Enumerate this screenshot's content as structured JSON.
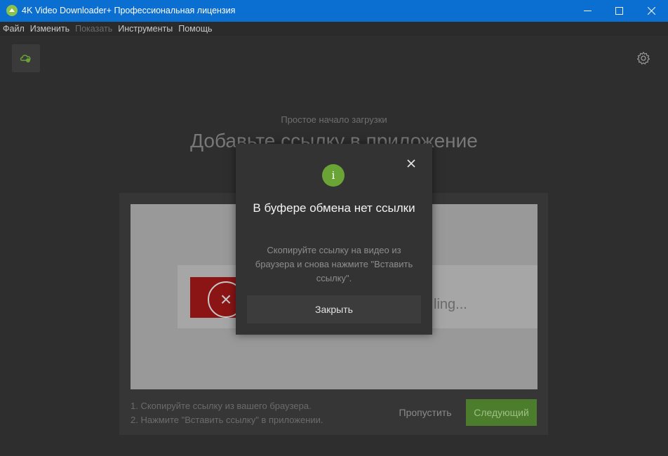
{
  "window": {
    "title": "4K Video Downloader+ Профессиональная лицензия"
  },
  "menu": {
    "items": [
      "Файл",
      "Изменить",
      "Показать",
      "Инструменты",
      "Помощь"
    ]
  },
  "toolbar": {
    "smart_mode_icon": "smart-mode-icon",
    "settings_icon": "gear-icon"
  },
  "onboarding": {
    "subtitle": "Простое начало загрузки",
    "title": "Добавьте ссылку в приложение",
    "preview_text": "ling...",
    "steps": [
      "1. Скопируйте ссылку из вашего браузера.",
      "2. Нажмите \"Вставить ссылку\" в приложении."
    ],
    "skip_label": "Пропустить",
    "next_label": "Следующий"
  },
  "dialog": {
    "title": "В буфере обмена нет ссылки",
    "message": "Скопируйте ссылку на видео из браузера и снова нажмите \"Вставить ссылку\".",
    "close_label": "Закрыть",
    "info_glyph": "i"
  },
  "colors": {
    "titlebar": "#0b6ed1",
    "accent_green": "#6aa336",
    "next_button": "#4c7d2c"
  }
}
